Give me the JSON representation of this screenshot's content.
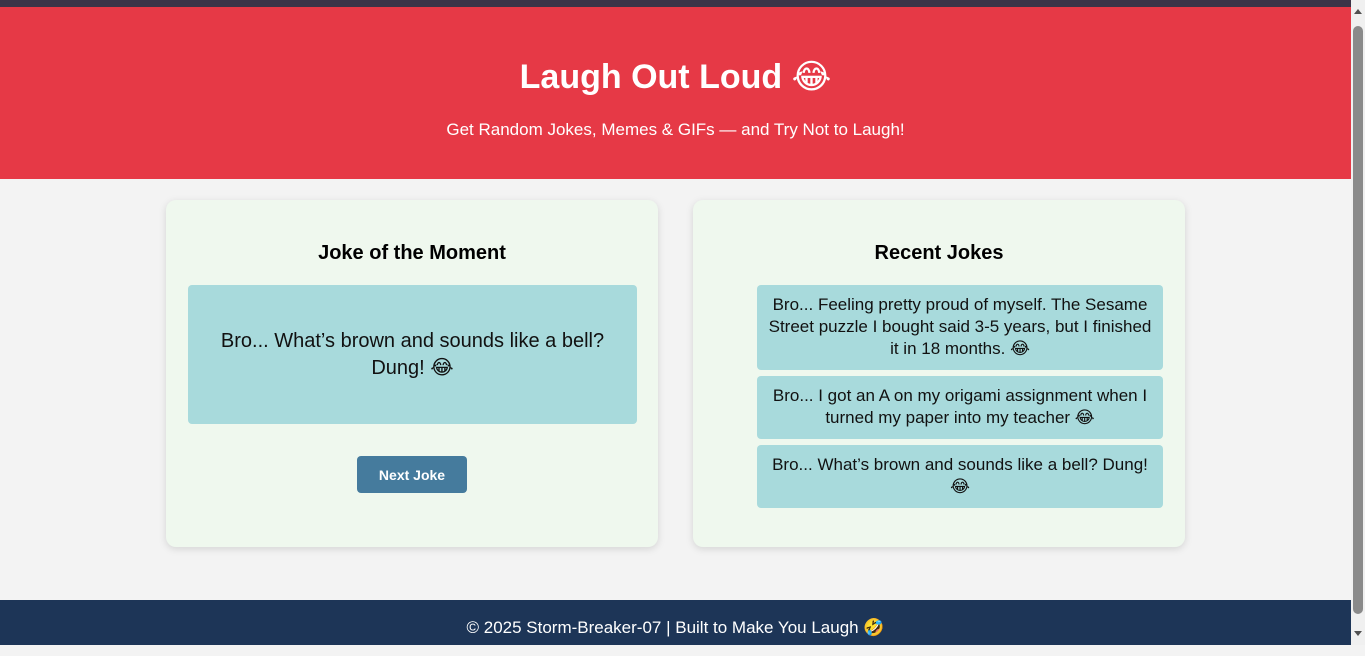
{
  "header": {
    "title": "Laugh Out Loud 😂",
    "subtitle": "Get Random Jokes, Memes & GIFs — and Try Not to Laugh!"
  },
  "joke_card": {
    "heading": "Joke of the Moment",
    "joke": "Bro... What’s brown and sounds like a bell? Dung! 😂",
    "button_label": "Next Joke"
  },
  "recent_card": {
    "heading": "Recent Jokes",
    "items": [
      {
        "text": "Bro... Feeling pretty proud of myself. The Sesame Street puzzle I bought said 3-5 years, but I finished it in 18 months. 😂"
      },
      {
        "text": "Bro... I got an A on my origami assignment when I turned my paper into my teacher 😂"
      },
      {
        "text": "Bro... What’s brown and sounds like a bell? Dung! 😂"
      }
    ]
  },
  "footer": {
    "text": "© 2025 Storm-Breaker-07 | Built to Make You Laugh 🤣"
  },
  "colors": {
    "header_bg": "#e63946",
    "card_bg": "#eff8ee",
    "joke_bg": "#a8dadc",
    "button_bg": "#457b9d",
    "footer_bg": "#1d3557"
  }
}
